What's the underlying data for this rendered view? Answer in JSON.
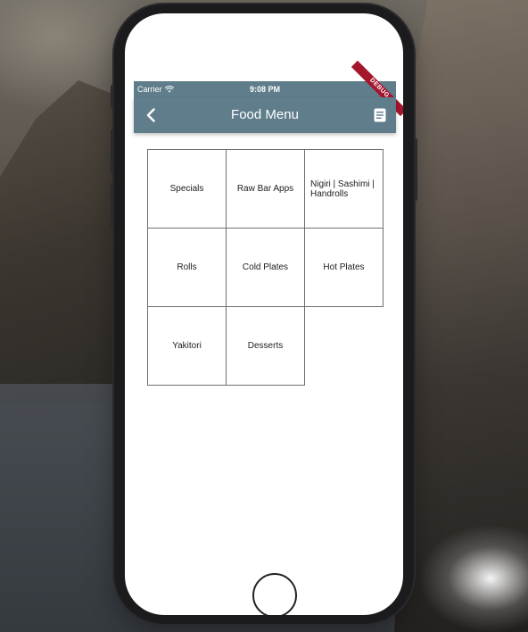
{
  "status_bar": {
    "carrier": "Carrier",
    "time": "9:08 PM"
  },
  "app_bar": {
    "title": "Food Menu",
    "back_icon": "chevron-left-icon",
    "menu_icon": "document-icon",
    "debug_banner": "DEBUG"
  },
  "menu": {
    "items": [
      "Specials",
      "Raw Bar Apps",
      "Nigiri | Sashimi | Handrolls",
      "Rolls",
      "Cold Plates",
      "Hot Plates",
      "Yakitori",
      "Desserts"
    ]
  },
  "colors": {
    "app_bar": "#607d8b",
    "debug_banner": "#a5152c",
    "cell_border": "#6f6f6f"
  }
}
